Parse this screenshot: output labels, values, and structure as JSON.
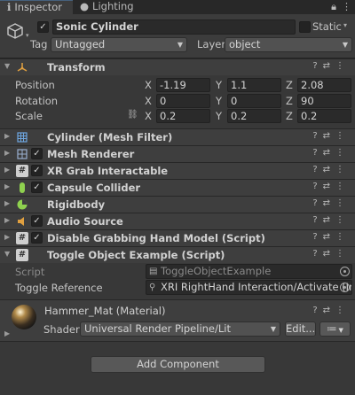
{
  "tabs": {
    "inspector": {
      "label": "Inspector",
      "icon": "info-icon"
    },
    "lighting": {
      "label": "Lighting",
      "icon": "bulb-icon"
    },
    "right_icons": "a ⋮"
  },
  "header": {
    "name": "Sonic Cylinder",
    "static_label": "Static",
    "tag_label": "Tag",
    "tag_value": "Untagged",
    "layer_label": "Layer",
    "layer_value": "object"
  },
  "transform": {
    "title": "Transform",
    "position": {
      "label": "Position",
      "x": "-1.19",
      "y": "1.1",
      "z": "2.08"
    },
    "rotation": {
      "label": "Rotation",
      "x": "0",
      "y": "0",
      "z": "90"
    },
    "scale": {
      "label": "Scale",
      "x": "0.2",
      "y": "0.2",
      "z": "0.2"
    },
    "axis": {
      "x": "X",
      "y": "Y",
      "z": "Z"
    }
  },
  "components": [
    {
      "name": "Cylinder (Mesh Filter)",
      "icon": "grid-icon"
    },
    {
      "name": "Mesh Renderer",
      "icon": "mesh-icon"
    },
    {
      "name": "XR Grab Interactable",
      "icon": "script-icon"
    },
    {
      "name": "Capsule Collider",
      "icon": "capsule-icon"
    },
    {
      "name": "Rigidbody",
      "icon": "rigidbody-icon"
    },
    {
      "name": "Audio Source",
      "icon": "speaker-icon"
    },
    {
      "name": "Disable Grabbing Hand Model (Script)",
      "icon": "script-icon"
    },
    {
      "name": "Toggle Object Example (Script)",
      "icon": "script-icon"
    }
  ],
  "toggle": {
    "script_label": "Script",
    "script_value": "ToggleObjectExample",
    "ref_label": "Toggle Reference",
    "ref_value": "XRI RightHand Interaction/Activate (Input"
  },
  "material": {
    "name": "Hammer_Mat (Material)",
    "shader_label": "Shader",
    "shader_value": "Universal Render Pipeline/Lit",
    "edit_label": "Edit...",
    "list_icon": "≔"
  },
  "footer": {
    "add_component": "Add Component"
  },
  "colors": {
    "background": "#383838",
    "header": "#3c3c3c",
    "field": "#2a2a2a",
    "tab_active": "#46607c"
  }
}
